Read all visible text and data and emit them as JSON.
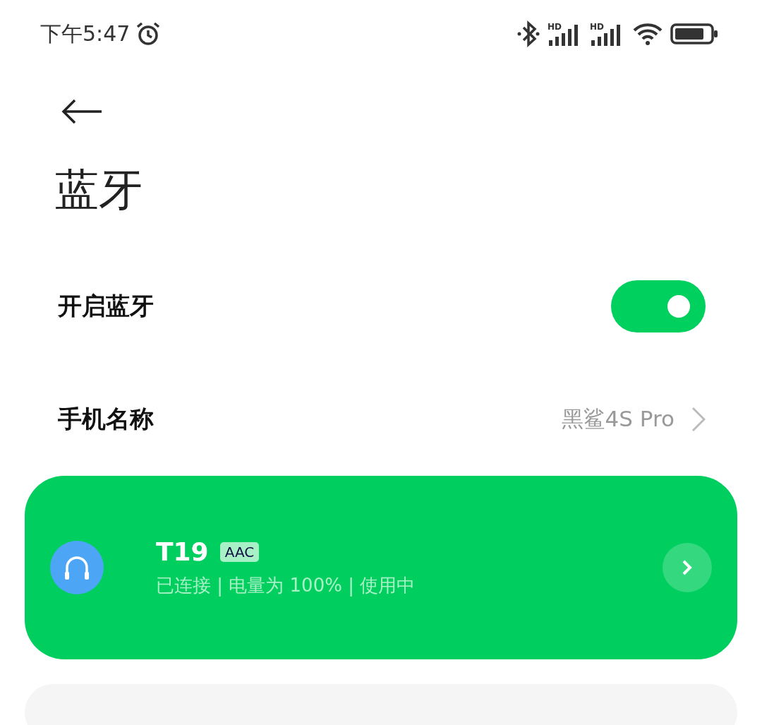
{
  "status_bar": {
    "time": "下午5:47",
    "signals": [
      {
        "label": "HD"
      },
      {
        "label": "HD"
      }
    ]
  },
  "title": "蓝牙",
  "bluetooth_toggle": {
    "label": "开启蓝牙",
    "on": true
  },
  "phone_name": {
    "label": "手机名称",
    "value": "黑鲨4S Pro"
  },
  "devices": [
    {
      "name": "T19",
      "codec": "AAC",
      "status": "已连接 | 电量为 100% | 使用中",
      "active": true
    }
  ]
}
